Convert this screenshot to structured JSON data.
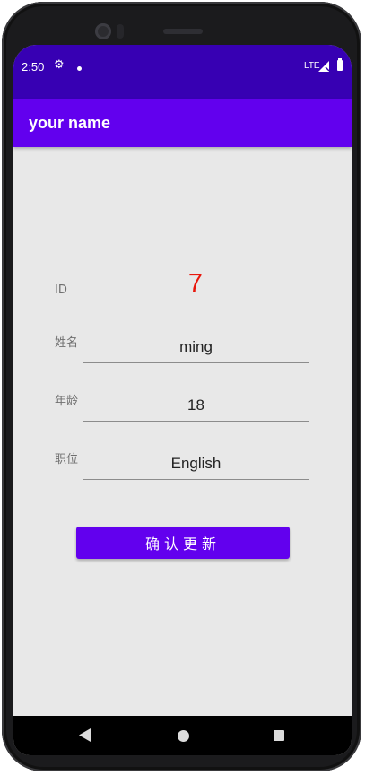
{
  "status_bar": {
    "time": "2:50",
    "network": "LTE",
    "icons": [
      "settings-icon",
      "notification-dot-icon",
      "signal-icon",
      "battery-icon"
    ]
  },
  "app_bar": {
    "title": "your name"
  },
  "form": {
    "id_label": "ID",
    "id_value": "7",
    "name_label": "姓名",
    "name_value": "ming",
    "age_label": "年龄",
    "age_value": "18",
    "position_label": "职位",
    "position_value": "English"
  },
  "confirm_button": {
    "label": "确认更新"
  },
  "colors": {
    "status_bar": "#3700b3",
    "primary": "#6200ee",
    "id_value": "#e8170c",
    "background": "#e8e8e8"
  },
  "nav_bar": {
    "buttons": [
      "back-icon",
      "home-icon",
      "recents-icon"
    ]
  }
}
